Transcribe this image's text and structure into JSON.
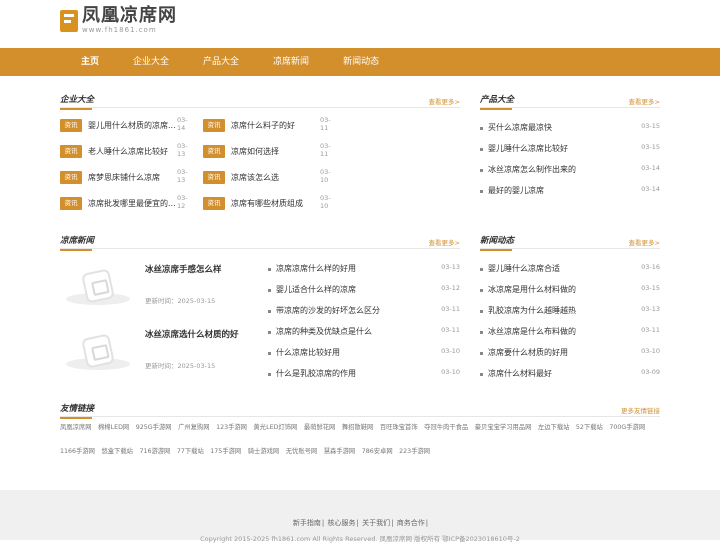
{
  "site": {
    "name": "凤凰凉席网",
    "domain": "www.fh1861.com"
  },
  "nav": [
    "主页",
    "企业大全",
    "产品大全",
    "凉席新闻",
    "新闻动态"
  ],
  "companies": {
    "title": "企业大全",
    "more": "查看更多>",
    "items": [
      {
        "tag": "资讯",
        "text": "婴儿用什么材质的凉席...",
        "date": "03-14"
      },
      {
        "tag": "资讯",
        "text": "凉席什么料子的好",
        "date": "03-11"
      },
      {
        "tag": "资讯",
        "text": "老人睡什么凉席比较好",
        "date": "03-13"
      },
      {
        "tag": "资讯",
        "text": "凉席如何选择",
        "date": "03-11"
      },
      {
        "tag": "资讯",
        "text": "席梦思床铺什么凉席",
        "date": "03-13"
      },
      {
        "tag": "资讯",
        "text": "凉席该怎么选",
        "date": "03-10"
      },
      {
        "tag": "资讯",
        "text": "凉席批发哪里最便宜的...",
        "date": "03-12"
      },
      {
        "tag": "资讯",
        "text": "凉席有哪些材质组成",
        "date": "03-10"
      }
    ]
  },
  "products": {
    "title": "产品大全",
    "more": "查看更多>",
    "items": [
      {
        "text": "买什么凉席最凉快",
        "date": "03-15"
      },
      {
        "text": "婴儿睡什么凉席比较好",
        "date": "03-15"
      },
      {
        "text": "冰丝凉席怎么制作出来的",
        "date": "03-14"
      },
      {
        "text": "最好的婴儿凉席",
        "date": "03-14"
      }
    ]
  },
  "mat_news": {
    "title": "凉席新闻",
    "more": "查看更多>",
    "cards": [
      {
        "title": "冰丝凉席手感怎么样",
        "time": "更新时间：2025-03-15"
      },
      {
        "title": "冰丝凉席选什么材质的好",
        "time": "更新时间：2025-03-15"
      }
    ],
    "items": [
      {
        "text": "凉席凉席什么样的好用",
        "date": "03-13"
      },
      {
        "text": "婴儿适合什么样的凉席",
        "date": "03-12"
      },
      {
        "text": "带凉席的沙发的好坏怎么区分",
        "date": "03-11"
      },
      {
        "text": "凉席的种类及优缺点是什么",
        "date": "03-11"
      },
      {
        "text": "什么凉席比较好用",
        "date": "03-10"
      },
      {
        "text": "什么是乳胶凉席的作用",
        "date": "03-10"
      }
    ]
  },
  "news": {
    "title": "新闻动态",
    "more": "查看更多>",
    "items": [
      {
        "text": "婴儿睡什么凉席合适",
        "date": "03-16"
      },
      {
        "text": "冰凉席是用什么材料做的",
        "date": "03-15"
      },
      {
        "text": "乳胶凉席为什么越睡越热",
        "date": "03-13"
      },
      {
        "text": "冰丝凉席是什么布料做的",
        "date": "03-11"
      },
      {
        "text": "凉席要什么材质的好用",
        "date": "03-10"
      },
      {
        "text": "凉席什么材料最好",
        "date": "03-09"
      }
    ]
  },
  "links": {
    "title": "友情链接",
    "more": "更多友情链接",
    "items": [
      "凤凰凉席网",
      "棉棉LED网",
      "925G手游网",
      "广州复购网",
      "123手游网",
      "黄光LED灯饰网",
      "最萌鲜花网",
      "舞招散鞋网",
      "百旺珠宝首饰",
      "夺冠牛肉干食品",
      "豪贝宝宝学习用品网",
      "左边下载站",
      "52下载站",
      "700G手游网",
      "1166手游网",
      "悠盒下载站",
      "716游游网",
      "77下载站",
      "175手游网",
      "骑士游戏网",
      "无忧账号网",
      "慧森手游网",
      "786安卓网",
      "223手游网"
    ]
  },
  "footer": {
    "nav": [
      "新手指南",
      "核心服务",
      "关于我们",
      "商务合作"
    ],
    "copyright": "Copyright 2015-2025 fh1861.com All Rights Reserved. 凤凰凉席网 版权所有 鄂ICP备2023018610号-2"
  },
  "colors": {
    "accent": "#d38f2c",
    "footer_bg": "#f0f0f0"
  }
}
